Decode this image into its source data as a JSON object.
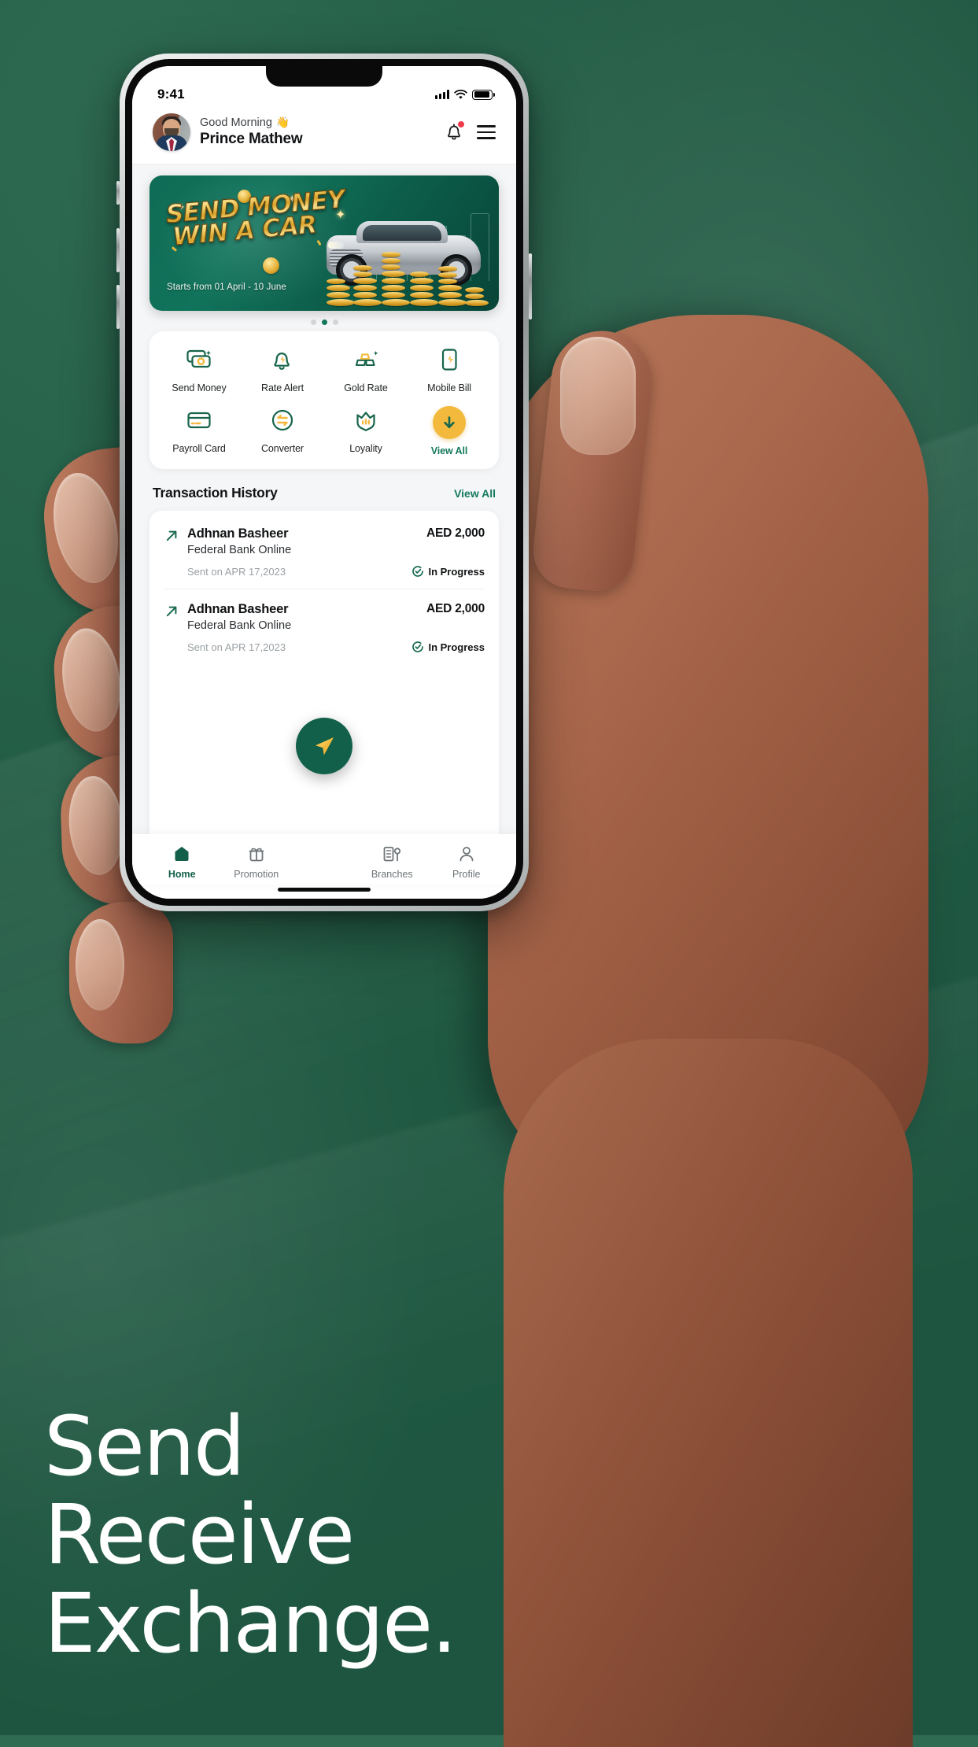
{
  "phone": {
    "status_bar": {
      "time": "9:41",
      "signal_icon": "cellular-signal-icon",
      "wifi_icon": "wifi-icon",
      "battery_icon": "battery-icon"
    },
    "header": {
      "avatar_name": "avatar",
      "greeting": "Good Morning",
      "wave_emoji": "👋",
      "user_name": "Prince Mathew",
      "bell_icon": "notification-bell-icon",
      "menu_icon": "hamburger-menu-icon"
    },
    "banner": {
      "title_line1": "SEND MONEY",
      "title_line2": "WIN A CAR",
      "subtitle": "Starts from 01 April - 10 June",
      "dots_total": 3,
      "dots_active_index": 1
    },
    "quick_actions": [
      {
        "label": "Send Money",
        "icon": "money-notes-icon"
      },
      {
        "label": "Rate Alert",
        "icon": "bell-bolt-icon"
      },
      {
        "label": "Gold Rate",
        "icon": "gold-bars-icon"
      },
      {
        "label": "Mobile Bill",
        "icon": "mobile-bolt-icon"
      },
      {
        "label": "Payroll Card",
        "icon": "credit-card-icon"
      },
      {
        "label": "Converter",
        "icon": "exchange-arrows-icon"
      },
      {
        "label": "Loyality",
        "icon": "crown-icon"
      },
      {
        "label": "View All",
        "icon": "arrow-down-circle-icon"
      }
    ],
    "transactions_section": {
      "title": "Transaction History",
      "view_all": "View All",
      "items": [
        {
          "name": "Adhnan Basheer",
          "bank": "Federal Bank Online",
          "amount": "AED 2,000",
          "date": "Sent on APR 17,2023",
          "status": "In Progress",
          "status_icon": "clock-check-icon",
          "direction_icon": "arrow-up-right-icon"
        },
        {
          "name": "Adhnan Basheer",
          "bank": "Federal Bank Online",
          "amount": "AED 2,000",
          "date": "Sent on APR 17,2023",
          "status": "In Progress",
          "status_icon": "clock-check-icon",
          "direction_icon": "arrow-up-right-icon"
        }
      ]
    },
    "fab": {
      "icon": "paper-plane-send-icon"
    },
    "bottom_nav": [
      {
        "label": "Home",
        "icon": "home-icon",
        "active": true
      },
      {
        "label": "Promotion",
        "icon": "gift-icon",
        "active": false
      },
      {
        "label": "Branches",
        "icon": "building-icon",
        "active": false
      },
      {
        "label": "Profile",
        "icon": "person-icon",
        "active": false
      }
    ]
  },
  "marketing": {
    "line1": "Send",
    "line2": "Receive",
    "line3": "Exchange."
  },
  "colors": {
    "brand_green": "#12604a",
    "accent_gold": "#f2b93c",
    "notification_red": "#ef3a4a",
    "background_green": "#2d6a51",
    "text_dark": "#101214",
    "text_muted": "#9aa0a4"
  }
}
